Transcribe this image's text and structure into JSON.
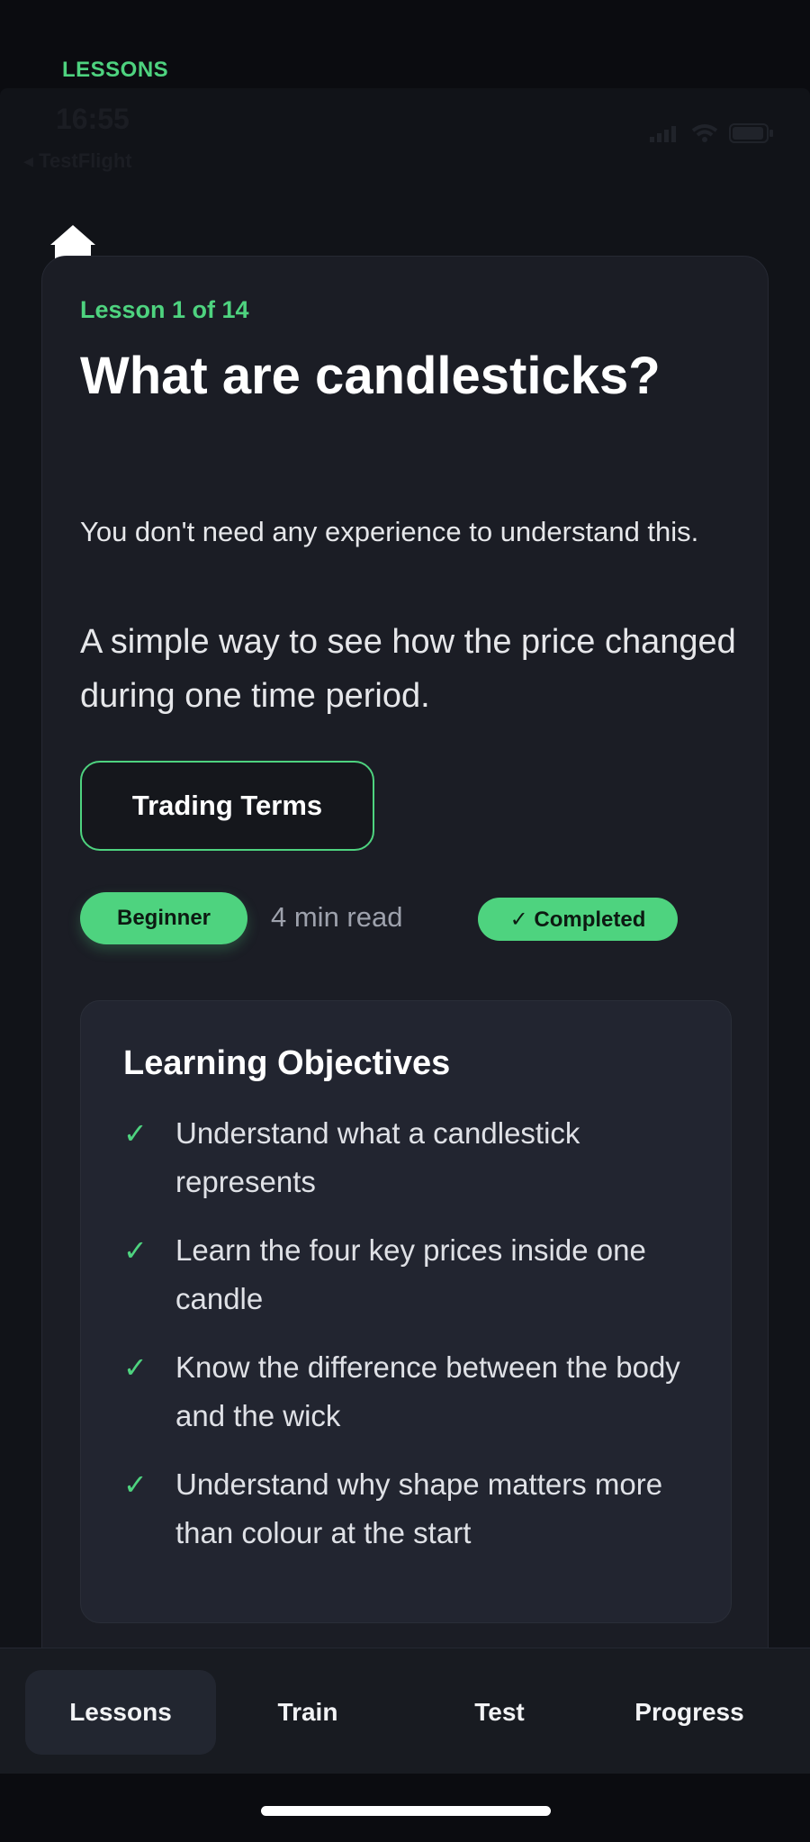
{
  "header": {
    "section_label": "LESSONS"
  },
  "status_bar": {
    "time": "16:55",
    "back_app": "◂ TestFlight"
  },
  "lesson": {
    "count": "Lesson 1 of 14",
    "title": "What are candlesticks?",
    "intro": "You don't need any experience to understand this.",
    "summary": "A simple way to see how the price changed during one time period.",
    "terms_button": "Trading Terms",
    "level": "Beginner",
    "read_time": "4 min read",
    "status": "✓ Completed"
  },
  "objectives": {
    "title": "Learning Objectives",
    "items": [
      "Understand what a candlestick represents",
      "Learn the four key prices inside one candle",
      "Know the difference between the body and the wick",
      "Understand why shape matters more than colour at the start"
    ]
  },
  "tabs": [
    {
      "label": "Lessons",
      "active": true
    },
    {
      "label": "Train",
      "active": false
    },
    {
      "label": "Test",
      "active": false
    },
    {
      "label": "Progress",
      "active": false
    }
  ],
  "colors": {
    "accent": "#4ed37f",
    "background": "#111318",
    "card": "#1b1d25"
  },
  "icons": {
    "home": "home-icon",
    "check": "check-icon",
    "signal": "signal-icon",
    "wifi": "wifi-icon",
    "battery": "battery-icon"
  }
}
